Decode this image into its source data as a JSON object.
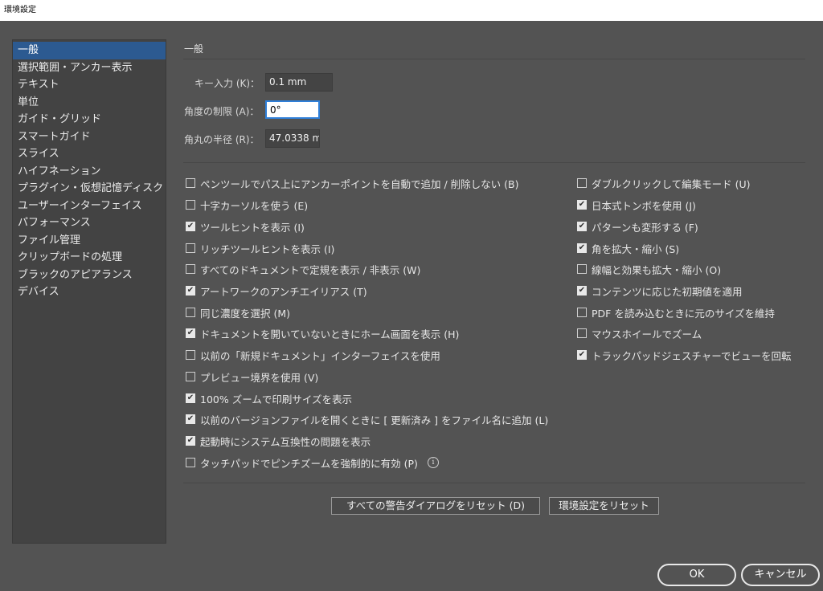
{
  "window": {
    "title": "環境設定"
  },
  "sidebar": {
    "items": [
      {
        "label": "一般",
        "selected": true
      },
      {
        "label": "選択範囲・アンカー表示"
      },
      {
        "label": "テキスト"
      },
      {
        "label": "単位"
      },
      {
        "label": "ガイド・グリッド"
      },
      {
        "label": "スマートガイド"
      },
      {
        "label": "スライス"
      },
      {
        "label": "ハイフネーション"
      },
      {
        "label": "プラグイン・仮想記憶ディスク"
      },
      {
        "label": "ユーザーインターフェイス"
      },
      {
        "label": "パフォーマンス"
      },
      {
        "label": "ファイル管理"
      },
      {
        "label": "クリップボードの処理"
      },
      {
        "label": "ブラックのアピアランス"
      },
      {
        "label": "デバイス"
      }
    ]
  },
  "main": {
    "section_title": "一般",
    "fields": {
      "key_input": {
        "label": "キー入力 (K)：",
        "value": "0.1 mm"
      },
      "angle": {
        "label": "角度の制限 (A)：",
        "value": "0°"
      },
      "corner_radius": {
        "label": "角丸の半径 (R)：",
        "value": "47.0338 m"
      }
    },
    "options_left": [
      {
        "label": "ペンツールでパス上にアンカーポイントを自動で追加 / 削除しない (B)",
        "checked": false
      },
      {
        "label": "十字カーソルを使う (E)",
        "checked": false
      },
      {
        "label": "ツールヒントを表示 (I)",
        "checked": true
      },
      {
        "label": "リッチツールヒントを表示 (I)",
        "checked": false
      },
      {
        "label": "すべてのドキュメントで定規を表示 / 非表示 (W)",
        "checked": false
      },
      {
        "label": "アートワークのアンチエイリアス (T)",
        "checked": true
      },
      {
        "label": "同じ濃度を選択 (M)",
        "checked": false
      },
      {
        "label": "ドキュメントを開いていないときにホーム画面を表示 (H)",
        "checked": true
      },
      {
        "label": "以前の「新規ドキュメント」インターフェイスを使用",
        "checked": false
      },
      {
        "label": "プレビュー境界を使用 (V)",
        "checked": false
      },
      {
        "label": "100% ズームで印刷サイズを表示",
        "checked": true
      },
      {
        "label": "以前のバージョンファイルを開くときに [ 更新済み ] をファイル名に追加 (L)",
        "checked": true
      },
      {
        "label": "起動時にシステム互換性の問題を表示",
        "checked": true
      },
      {
        "label": "タッチパッドでピンチズームを強制的に有効 (P)",
        "checked": false,
        "info": "i"
      }
    ],
    "options_right": [
      {
        "label": "ダブルクリックして編集モード (U)",
        "checked": false
      },
      {
        "label": "日本式トンボを使用 (J)",
        "checked": true
      },
      {
        "label": "パターンも変形する (F)",
        "checked": true
      },
      {
        "label": "角を拡大・縮小 (S)",
        "checked": true
      },
      {
        "label": "線幅と効果も拡大・縮小 (O)",
        "checked": false
      },
      {
        "label": "コンテンツに応じた初期値を適用",
        "checked": true
      },
      {
        "label": "PDF を読み込むときに元のサイズを維持",
        "checked": false
      },
      {
        "label": "マウスホイールでズーム",
        "checked": false
      },
      {
        "label": "トラックパッドジェスチャーでビューを回転",
        "checked": true
      }
    ],
    "buttons": {
      "reset_warnings": "すべての警告ダイアログをリセット (D)",
      "reset_prefs": "環境設定をリセット"
    }
  },
  "footer": {
    "ok": "OK",
    "cancel": "キャンセル"
  }
}
